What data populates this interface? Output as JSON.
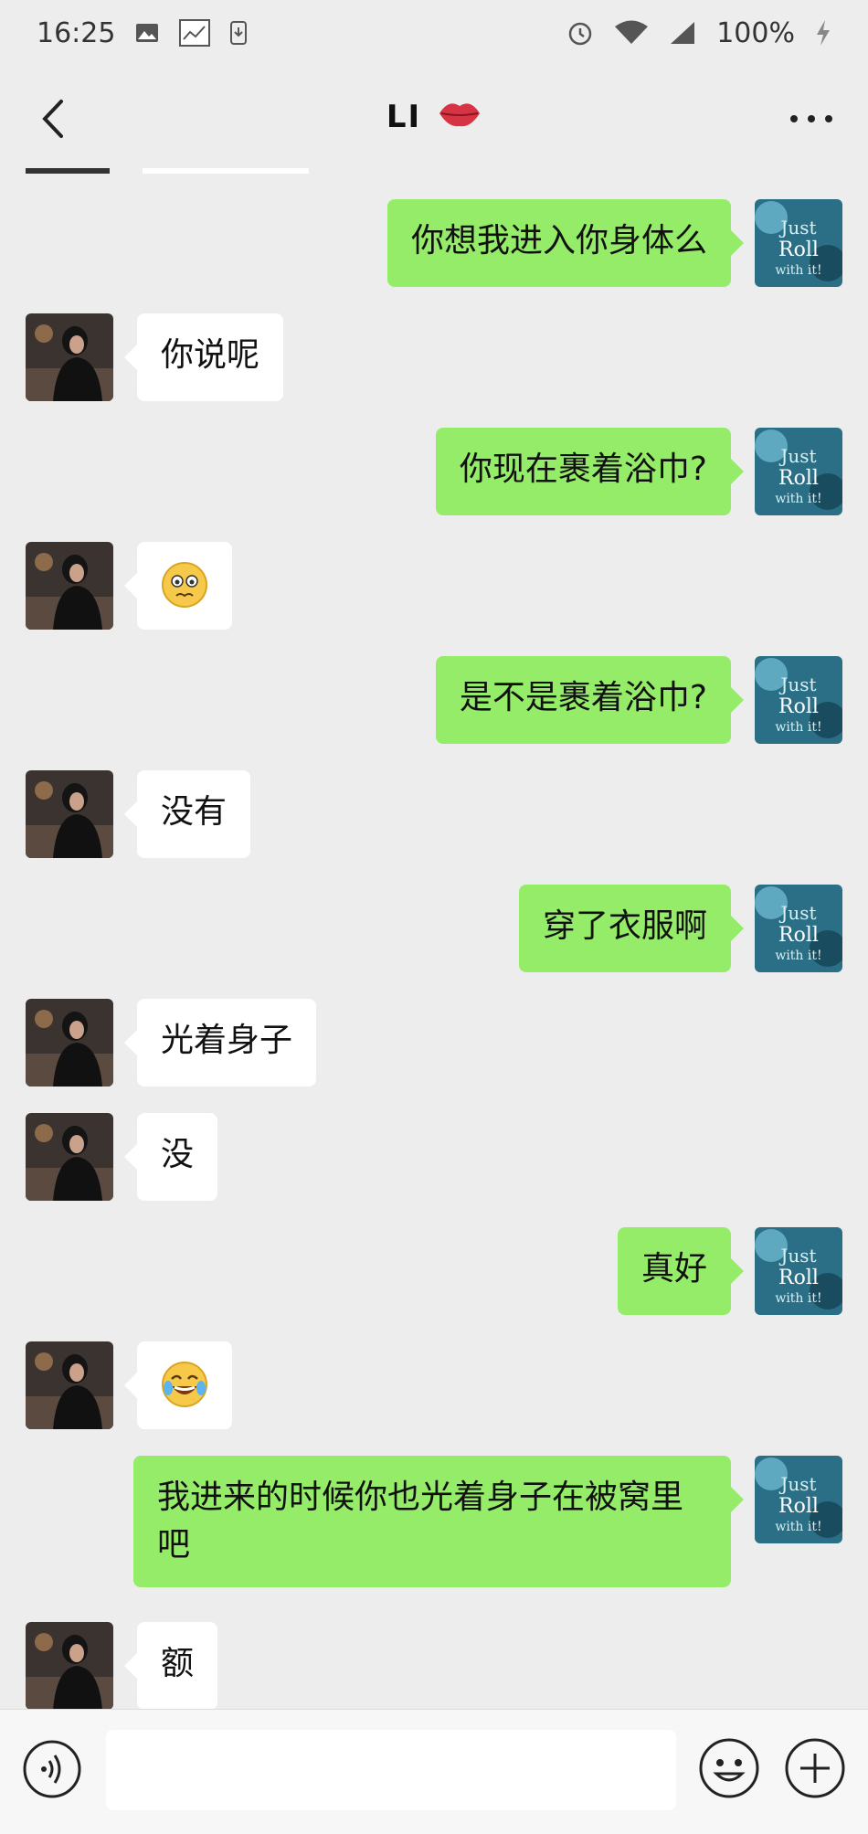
{
  "status": {
    "time": "16:25",
    "battery": "100%"
  },
  "chat_title": "LI",
  "messages": [
    {
      "side": "right",
      "text": "你想我进入你身体么"
    },
    {
      "side": "left",
      "text": "你说呢"
    },
    {
      "side": "right",
      "text": "你现在裹着浴巾?"
    },
    {
      "side": "left",
      "emoji": "worried-face-emoji"
    },
    {
      "side": "right",
      "text": "是不是裹着浴巾?"
    },
    {
      "side": "left",
      "text": "没有"
    },
    {
      "side": "right",
      "text": "穿了衣服啊"
    },
    {
      "side": "left",
      "text": "光着身子"
    },
    {
      "side": "left",
      "text": "没"
    },
    {
      "side": "right",
      "text": "真好"
    },
    {
      "side": "left",
      "emoji": "tears-of-joy-emoji"
    },
    {
      "side": "right",
      "text": "我进来的时候你也光着身子在被窝里吧"
    },
    {
      "side": "left",
      "text": "额"
    }
  ],
  "input": {
    "placeholder": ""
  },
  "colors": {
    "background": "#ededed",
    "sent_bubble": "#95ec69",
    "received_bubble": "#ffffff"
  },
  "icons": {
    "back": "chevron-left-icon",
    "more": "more-dots-icon",
    "title_decoration": "lips-icon",
    "voice": "voice-icon",
    "emoji": "emoji-icon",
    "plus": "plus-icon"
  }
}
